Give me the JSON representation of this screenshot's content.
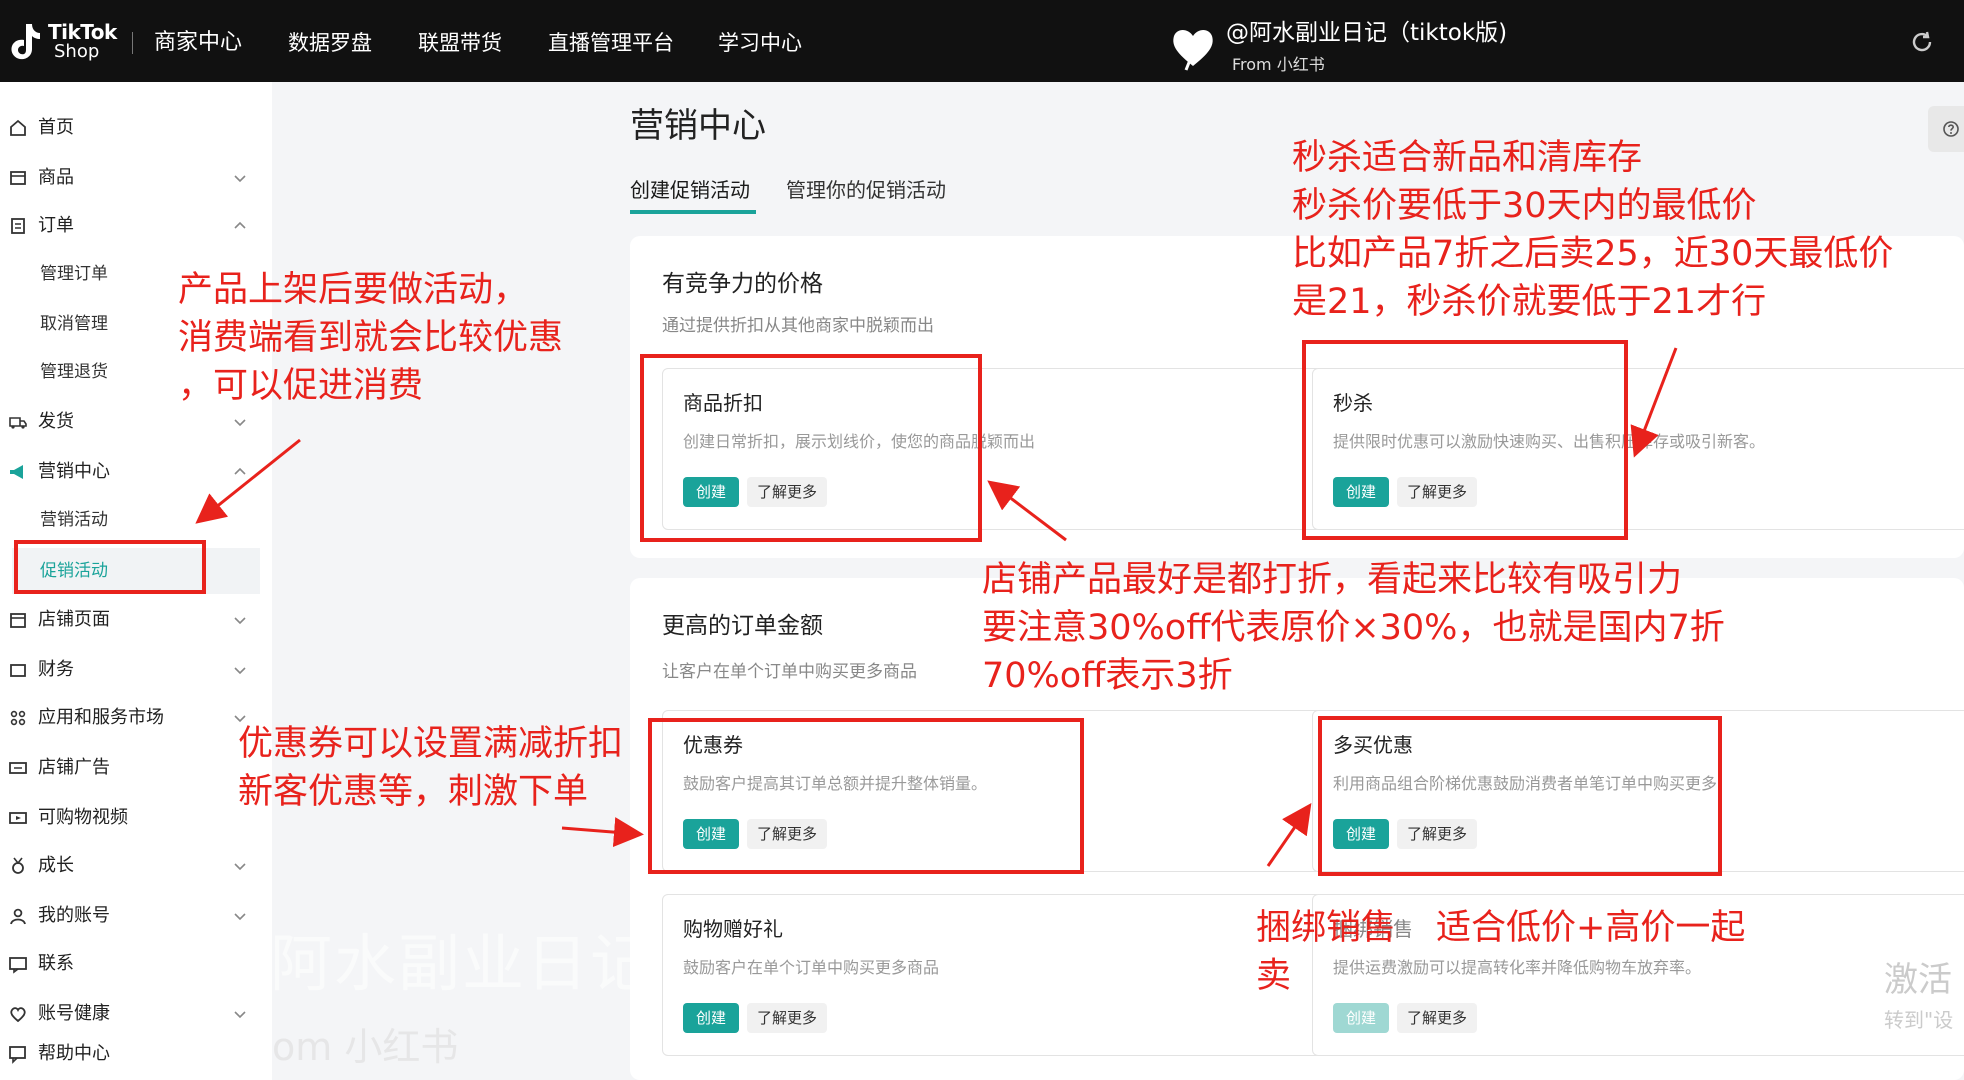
{
  "topbar": {
    "brand_line1": "TikTok",
    "brand_line2": "Shop",
    "nav": [
      "商家中心",
      "数据罗盘",
      "联盟带货",
      "直播管理平台",
      "学习中心"
    ],
    "watermark_title": "@阿水副业日记（tiktok版)",
    "watermark_from": "From 小红书"
  },
  "sidebar": {
    "items": [
      {
        "label": "首页",
        "icon": "home-icon"
      },
      {
        "label": "商品",
        "icon": "product-icon"
      },
      {
        "label": "订单",
        "icon": "order-icon"
      },
      {
        "label": "管理订单"
      },
      {
        "label": "取消管理"
      },
      {
        "label": "管理退货"
      },
      {
        "label": "发货",
        "icon": "truck-icon"
      },
      {
        "label": "营销中心",
        "icon": "megaphone-icon"
      },
      {
        "label": "营销活动"
      },
      {
        "label": "促销活动"
      },
      {
        "label": "店铺页面",
        "icon": "store-icon"
      },
      {
        "label": "财务",
        "icon": "wallet-icon"
      },
      {
        "label": "应用和服务市场",
        "icon": "apps-icon"
      },
      {
        "label": "店铺广告",
        "icon": "ads-icon"
      },
      {
        "label": "可购物视频",
        "icon": "video-icon"
      },
      {
        "label": "成长",
        "icon": "medal-icon"
      },
      {
        "label": "我的账号",
        "icon": "user-icon"
      },
      {
        "label": "联系",
        "icon": "chat-icon"
      },
      {
        "label": "账号健康",
        "icon": "health-icon"
      },
      {
        "label": "帮助中心",
        "icon": "help-icon"
      }
    ],
    "watermark": "阿水副业日记",
    "watermark_sub": "om 小红书"
  },
  "main": {
    "title": "营销中心",
    "tabs": [
      "创建促销活动",
      "管理你的促销活动"
    ],
    "section1": {
      "title": "有竞争力的价格",
      "desc": "通过提供折扣从其他商家中脱颖而出",
      "cards": [
        {
          "title": "商品折扣",
          "desc": "创建日常折扣，展示划线价，使您的商品脱颖而出",
          "create": "创建",
          "more": "了解更多"
        },
        {
          "title": "秒杀",
          "desc": "提供限时优惠可以激励快速购买、出售积压库存或吸引新客。",
          "create": "创建",
          "more": "了解更多"
        }
      ]
    },
    "section2": {
      "title": "更高的订单金额",
      "desc": "让客户在单个订单中购买更多商品",
      "cards": [
        {
          "title": "优惠券",
          "desc": "鼓励客户提高其订单总额并提升整体销量。",
          "create": "创建",
          "more": "了解更多"
        },
        {
          "title": "多买优惠",
          "desc": "利用商品组合阶梯优惠鼓励消费者单笔订单中购买更多",
          "create": "创建",
          "more": "了解更多"
        },
        {
          "title": "购物赠好礼",
          "desc": "鼓励客户在单个订单中购买更多商品",
          "create": "创建",
          "more": "了解更多"
        },
        {
          "title": "捆绑销售",
          "desc": "提供运费激励可以提高转化率并降低购物车放弃率。",
          "create": "创建",
          "more": "了解更多"
        }
      ]
    }
  },
  "annotations": {
    "left_top": [
      "产品上架后要做活动，",
      "消费端看到就会比较优惠",
      "，可以促进消费"
    ],
    "right_top": [
      "秒杀适合新品和清库存",
      "秒杀价要低于30天内的最低价",
      "比如产品7折之后卖25，近30天最低价",
      "是21，秒杀价就要低于21才行"
    ],
    "middle": [
      "店铺产品最好是都打折，看起来比较有吸引力",
      "要注意30%off代表原价×30%，也就是国内7折",
      "70%off表示3折"
    ],
    "left_bottom": [
      "优惠券可以设置满减折扣",
      "新客优惠等，刺激下单"
    ],
    "bundle_label": "捆绑销售",
    "bundle_note": "适合低价+高价一起",
    "bundle_note2": "卖",
    "color": "#e8221c"
  },
  "corner_watermark": [
    "激活",
    "转到\"设"
  ]
}
